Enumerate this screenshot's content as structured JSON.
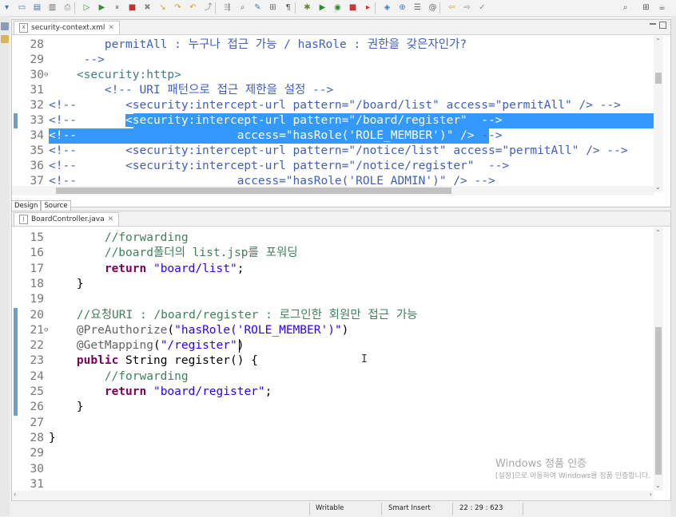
{
  "toolbar": {
    "icons": [
      "new-icon",
      "save-icon",
      "save-all-icon",
      "print-icon",
      "skip-icon",
      "resume-icon",
      "suspend-icon",
      "terminate-icon",
      "disconnect-icon",
      "step-into-icon",
      "step-over-icon",
      "step-return-icon",
      "drop-frame-icon",
      "use-step-filters-icon",
      "open-type-icon",
      "search-icon",
      "toggle-mark-icon",
      "toggle-block-icon",
      "show-whitespace-icon",
      "debug-icon",
      "run-icon",
      "coverage-icon",
      "stop-server-icon",
      "external-tools-icon",
      "new-class-icon",
      "new-server-icon",
      "open-task-icon",
      "annotation-icon",
      "back-icon",
      "forward-icon",
      "pin-icon"
    ],
    "right_icons": [
      "search-icon",
      "perspective-icon",
      "java-perspective-icon"
    ]
  },
  "top_editor": {
    "tab_label": "security-context.xml",
    "lines": [
      {
        "n": "28",
        "segs": [
          [
            "        ",
            "p"
          ],
          [
            "permitAll : 누구나 접근 가능 / hasRole : 권한을 갖은자인가?",
            "com"
          ]
        ]
      },
      {
        "n": "29",
        "segs": [
          [
            "     -->",
            "com"
          ]
        ]
      },
      {
        "n": "30",
        "fold": "⊖",
        "segs": [
          [
            "    ",
            "p"
          ],
          [
            "<security:http>",
            "tag"
          ]
        ]
      },
      {
        "n": "31",
        "segs": [
          [
            "        ",
            "p"
          ],
          [
            "<!-- URI 패턴으로 접근 제한을 설정 -->",
            "com"
          ]
        ]
      },
      {
        "n": "32",
        "segs": [
          [
            "<!--       <security:intercept-url pattern=\"/board/list\" access=\"permitAll\" /> -->",
            "com"
          ]
        ]
      },
      {
        "n": "33",
        "segs": [
          [
            "<!--       ",
            "com"
          ],
          [
            "<security:intercept-url pattern=\"/board/register\"  -->",
            "sel"
          ]
        ],
        "sel_extend": true
      },
      {
        "n": "34",
        "segs": [
          [
            "<!--                       access=\"hasRole('ROLE_MEMBER')\" /> ",
            "sel"
          ],
          [
            "-->",
            "com"
          ]
        ],
        "sel_from_start": true
      },
      {
        "n": "35",
        "segs": [
          [
            "<!--       <security:intercept-url pattern=\"/notice/list\" access=\"permitAll\" /> -->",
            "com"
          ]
        ]
      },
      {
        "n": "36",
        "segs": [
          [
            "<!--       <security:intercept-url pattern=\"/notice/register\"  -->",
            "com"
          ]
        ]
      },
      {
        "n": "37",
        "segs": [
          [
            "<!--                       access=\"hasRole('ROLE_ADMIN')\" /> -->",
            "com"
          ]
        ]
      }
    ]
  },
  "design_tabs": [
    "Design",
    "Source"
  ],
  "bottom_editor": {
    "tab_label": "BoardController.java",
    "lines": [
      {
        "n": "15",
        "segs": [
          [
            "        //forwarding",
            "jcom"
          ]
        ]
      },
      {
        "n": "16",
        "segs": [
          [
            "        //board폴더의 list.jsp를 포워딩",
            "jcom"
          ]
        ]
      },
      {
        "n": "17",
        "segs": [
          [
            "        ",
            "p"
          ],
          [
            "return",
            "kw"
          ],
          [
            " ",
            "p"
          ],
          [
            "\"board/list\"",
            "str"
          ],
          [
            ";",
            "p"
          ]
        ]
      },
      {
        "n": "18",
        "segs": [
          [
            "    }",
            "p"
          ]
        ]
      },
      {
        "n": "19",
        "segs": [
          [
            "",
            "p"
          ]
        ]
      },
      {
        "n": "20",
        "segs": [
          [
            "    //요청URI : /board/register : 로그인한 회원만 접근 가능",
            "jcom"
          ]
        ]
      },
      {
        "n": "21",
        "fold": "⊖",
        "segs": [
          [
            "    ",
            "p"
          ],
          [
            "@PreAuthorize",
            "ann"
          ],
          [
            "(",
            "p"
          ],
          [
            "\"hasRole('ROLE_MEMBER')\"",
            "str"
          ],
          [
            ")",
            "p"
          ]
        ]
      },
      {
        "n": "22",
        "segs": [
          [
            "    ",
            "p"
          ],
          [
            "@GetMapping",
            "ann"
          ],
          [
            "(",
            "p"
          ],
          [
            "\"/register\"",
            "str"
          ],
          [
            ")",
            "p"
          ]
        ]
      },
      {
        "n": "23",
        "segs": [
          [
            "    ",
            "p"
          ],
          [
            "public",
            "kw"
          ],
          [
            " String register() {",
            "p"
          ]
        ]
      },
      {
        "n": "24",
        "segs": [
          [
            "        //forwarding",
            "jcom"
          ]
        ]
      },
      {
        "n": "25",
        "segs": [
          [
            "        ",
            "p"
          ],
          [
            "return",
            "kw"
          ],
          [
            " ",
            "p"
          ],
          [
            "\"board/register\"",
            "str"
          ],
          [
            ";",
            "p"
          ]
        ]
      },
      {
        "n": "26",
        "segs": [
          [
            "    }",
            "p"
          ]
        ]
      },
      {
        "n": "27",
        "segs": [
          [
            "",
            "p"
          ]
        ]
      },
      {
        "n": "28",
        "segs": [
          [
            "}",
            "p"
          ]
        ]
      },
      {
        "n": "29",
        "segs": [
          [
            "",
            "p"
          ]
        ]
      },
      {
        "n": "30",
        "segs": [
          [
            "",
            "p"
          ]
        ]
      },
      {
        "n": "31",
        "segs": [
          [
            "",
            "p"
          ]
        ]
      }
    ]
  },
  "watermark": {
    "title": "Windows 정품 인증",
    "subtitle": "[설정]으로 이동하여 Windows를 정품 인증합니다."
  },
  "status_bar": {
    "mode": "Writable",
    "insert": "Smart Insert",
    "position": "22 : 29 : 623"
  },
  "colors": {
    "selection": "#3399ff",
    "xml_comment": "#3f5fbf",
    "xml_tag": "#3f7f7f",
    "java_keyword": "#7f0055",
    "java_string": "#2a00ff",
    "java_comment": "#3f7f5f",
    "annotation": "#646464"
  }
}
